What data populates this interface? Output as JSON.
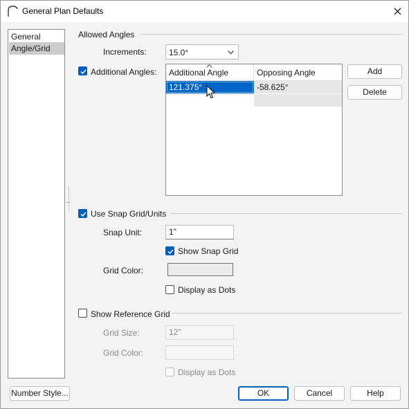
{
  "window": {
    "title": "General Plan Defaults",
    "close_icon": "close-icon"
  },
  "nav": {
    "items": [
      {
        "label": "General",
        "selected": false
      },
      {
        "label": "Angle/Grid",
        "selected": true
      }
    ]
  },
  "allowed_angles": {
    "section_title": "Allowed Angles",
    "increments_label": "Increments:",
    "increments_value": "15.0°",
    "additional_angles_label": "Additional Angles:",
    "additional_angles_checked": true,
    "table": {
      "columns": [
        "Additional Angle",
        "Opposing Angle"
      ],
      "rows": [
        [
          "121.375°",
          "-58.625°"
        ],
        [
          "",
          ""
        ]
      ]
    },
    "add_label": "Add",
    "delete_label": "Delete"
  },
  "snap_grid": {
    "section_title": "Use Snap Grid/Units",
    "checked": true,
    "snap_unit_label": "Snap Unit:",
    "snap_unit_value": "1\"",
    "show_snap_grid_label": "Show Snap Grid",
    "show_snap_grid_checked": true,
    "grid_color_label": "Grid Color:",
    "grid_color_value": "#ebebeb",
    "display_as_dots_label": "Display as Dots",
    "display_as_dots_checked": false
  },
  "reference_grid": {
    "section_title": "Show Reference Grid",
    "checked": false,
    "grid_size_label": "Grid Size:",
    "grid_size_value": "12\"",
    "grid_color_label": "Grid Color:",
    "display_as_dots_label": "Display as Dots",
    "display_as_dots_checked": false
  },
  "footer": {
    "number_style_label": "Number Style...",
    "ok_label": "OK",
    "cancel_label": "Cancel",
    "help_label": "Help"
  },
  "colors": {
    "accent": "#005fb8",
    "selection": "#0063c7",
    "dialog_bg": "#f3f3f3"
  }
}
